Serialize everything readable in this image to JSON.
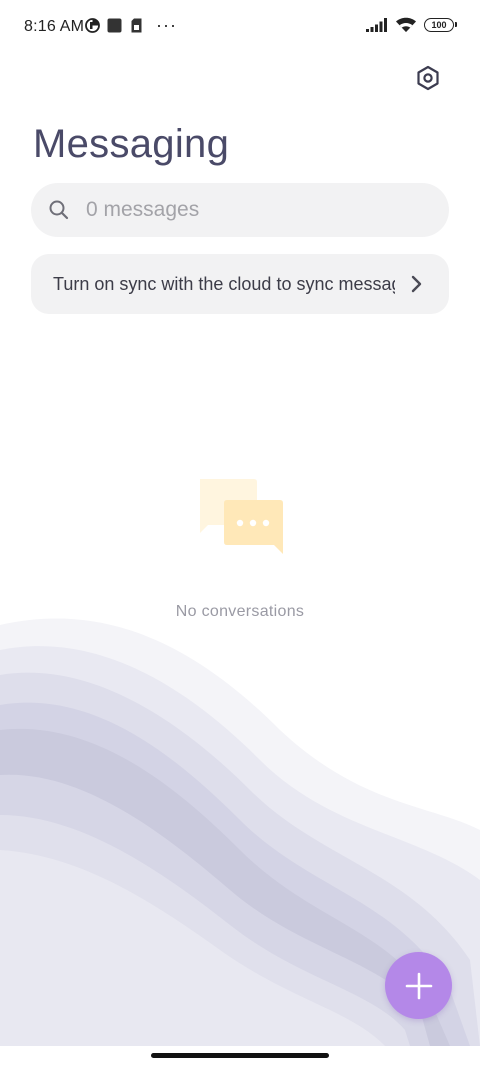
{
  "status_bar": {
    "time": "8:16 AM",
    "overflow": "···",
    "battery": "100",
    "icons": [
      "data-saver-icon",
      "square-notification-icon",
      "sim-card-icon",
      "signal-icon",
      "wifi-icon",
      "battery-icon"
    ]
  },
  "header": {
    "title": "Messaging",
    "settings_icon": "settings-hex-icon"
  },
  "search": {
    "placeholder": "0 messages"
  },
  "sync_banner": {
    "text": "Turn on sync with the cloud to sync messages"
  },
  "empty_state": {
    "message": "No conversations",
    "icon": "chat-bubbles-icon"
  },
  "fab": {
    "icon": "plus-icon",
    "color": "#b488e8"
  },
  "colors": {
    "title": "#4a4a68",
    "search_bg": "#f2f2f3",
    "wave_dark": "#cacadd",
    "wave_light": "#f4f4f8"
  }
}
